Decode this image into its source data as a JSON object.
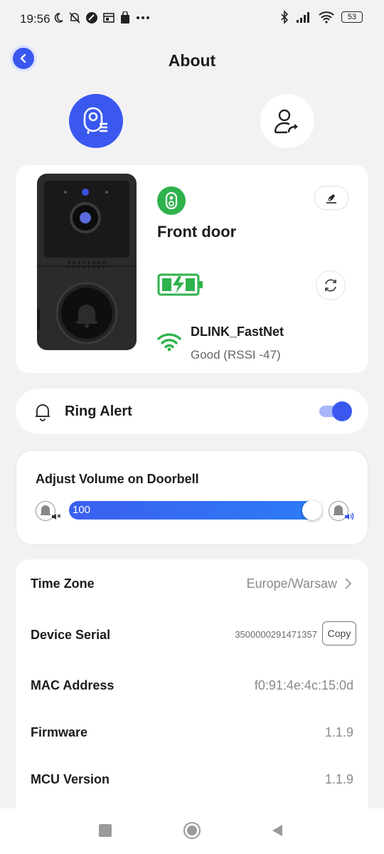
{
  "status_bar": {
    "time": "19:56",
    "battery": "53"
  },
  "header": {
    "title": "About"
  },
  "device": {
    "name": "Front door",
    "wifi_name": "DLINK_FastNet",
    "wifi_status": "Good (RSSI -47)"
  },
  "ring_alert": {
    "label": "Ring Alert",
    "enabled": true
  },
  "volume": {
    "title": "Adjust Volume on Doorbell",
    "value": "100",
    "max": 100
  },
  "info": {
    "time_zone_label": "Time Zone",
    "time_zone_value": "Europe/Warsaw",
    "serial_label": "Device Serial",
    "serial_value": "3500000291471357",
    "copy_label": "Copy",
    "mac_label": "MAC Address",
    "mac_value": "f0:91:4e:4c:15:0d",
    "firmware_label": "Firmware",
    "firmware_value": "1.1.9",
    "mcu_label": "MCU Version",
    "mcu_value": "1.1.9"
  },
  "colors": {
    "accent": "#3a58f0",
    "online": "#2fb24c",
    "background": "#f2f2f4"
  }
}
